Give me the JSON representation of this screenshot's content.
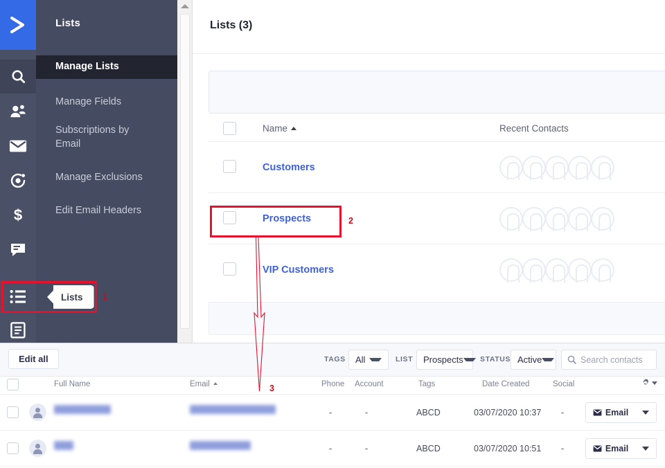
{
  "brand": {
    "logo_icon": "activecampaign-chevron-logo",
    "accent_blue": "#356ae6"
  },
  "icon_rail": [
    {
      "name": "search-icon",
      "active": true
    },
    {
      "name": "contacts-icon",
      "active": false
    },
    {
      "name": "mail-envelope-icon",
      "active": false
    },
    {
      "name": "automations-icon",
      "active": false
    },
    {
      "name": "deals-dollar-icon",
      "active": false
    },
    {
      "name": "conversations-chat-icon",
      "active": false
    },
    {
      "name": "lists-icon",
      "active": false
    },
    {
      "name": "forms-icon",
      "active": false
    }
  ],
  "subnav": {
    "title": "Lists",
    "items": [
      {
        "label": "Manage Lists",
        "active": true
      },
      {
        "label": "Manage Fields",
        "active": false
      },
      {
        "label": "Subscriptions by Email",
        "active": false
      },
      {
        "label": "Manage Exclusions",
        "active": false
      },
      {
        "label": "Edit Email Headers",
        "active": false
      }
    ]
  },
  "lists_panel": {
    "title": "Lists (3)",
    "columns": {
      "name": "Name",
      "recent_contacts": "Recent Contacts"
    },
    "sort_indicator": "ascending",
    "rows": [
      {
        "name": "Customers",
        "recent_contacts": 5
      },
      {
        "name": "Prospects",
        "recent_contacts": 5
      },
      {
        "name": "VIP Customers",
        "recent_contacts": 5
      }
    ]
  },
  "contacts_panel": {
    "edit_all_label": "Edit all",
    "filters": [
      {
        "label": "TAGS",
        "value": "All"
      },
      {
        "label": "LIST",
        "value": "Prospects"
      },
      {
        "label": "STATUS",
        "value": "Active"
      }
    ],
    "search": {
      "placeholder": "Search contacts",
      "icon": "search-icon"
    },
    "settings_icon": "gear-icon",
    "columns": [
      "Full Name",
      "Email",
      "Phone",
      "Account",
      "Tags",
      "Date Created",
      "Social"
    ],
    "sorted_column": "Email",
    "sort_indicator": "ascending",
    "rows": [
      {
        "full_name": "atul sharma",
        "email": "atul.order90@gmail.com",
        "phone": "-",
        "account": "-",
        "tags": "ABCD",
        "date_created": "03/07/2020 10:37",
        "social": "-",
        "action_label": "Email",
        "action_icon": "mail-envelope-icon"
      },
      {
        "full_name": "atul",
        "email": "atul@gmail.com",
        "phone": "-",
        "account": "-",
        "tags": "ABCD",
        "date_created": "03/07/2020 10:51",
        "social": "-",
        "action_label": "Email",
        "action_icon": "mail-envelope-icon"
      }
    ]
  },
  "annotations": {
    "color": "#e8112d",
    "items": [
      {
        "number": "1",
        "target": "lists-rail-icon",
        "tooltip": "Lists"
      },
      {
        "number": "2",
        "target": "prospects-list-row"
      },
      {
        "number": "3",
        "target": "contacts-table"
      }
    ]
  }
}
